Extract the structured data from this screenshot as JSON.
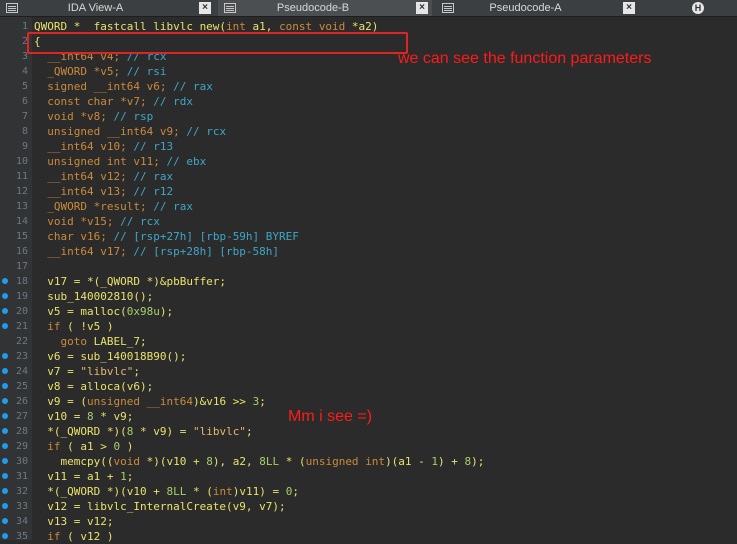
{
  "tabs": [
    {
      "label": "IDA View-A",
      "close": "×"
    },
    {
      "label": "Pseudocode-B",
      "close": "×"
    },
    {
      "label": "Pseudocode-A",
      "close": "×"
    },
    {
      "label": "",
      "icon": "hex-view-icon"
    }
  ],
  "annotations": {
    "params_note": "we can see the function parameters",
    "see_note": "Mm i see =)"
  },
  "code": {
    "lines": [
      {
        "n": "1",
        "parts": [
          [
            "QWORD *__fastcall libvlc_new(int a1, const void *a2)",
            "y"
          ]
        ],
        "dot": false
      },
      {
        "n": "2",
        "parts": [
          [
            "{",
            "y"
          ]
        ],
        "dot": false
      },
      {
        "n": "3",
        "parts": [
          [
            "  __int64 v4; // rcx",
            "c"
          ]
        ],
        "dot": false
      },
      {
        "n": "4",
        "parts": [
          [
            "  _QWORD *v5; // rsi",
            "c"
          ]
        ],
        "dot": false
      },
      {
        "n": "5",
        "parts": [
          [
            "  signed __int64 v6; // rax",
            "c"
          ]
        ],
        "dot": false
      },
      {
        "n": "6",
        "parts": [
          [
            "  const char *v7; // rdx",
            "c"
          ]
        ],
        "dot": false
      },
      {
        "n": "7",
        "parts": [
          [
            "  void *v8; // rsp",
            "c"
          ]
        ],
        "dot": false
      },
      {
        "n": "8",
        "parts": [
          [
            "  unsigned __int64 v9; // rcx",
            "c"
          ]
        ],
        "dot": false
      },
      {
        "n": "9",
        "parts": [
          [
            "  __int64 v10; // r13",
            "c"
          ]
        ],
        "dot": false
      },
      {
        "n": "10",
        "parts": [
          [
            "  unsigned int v11; // ebx",
            "c"
          ]
        ],
        "dot": false
      },
      {
        "n": "11",
        "parts": [
          [
            "  __int64 v12; // rax",
            "c"
          ]
        ],
        "dot": false
      },
      {
        "n": "12",
        "parts": [
          [
            "  __int64 v13; // r12",
            "c"
          ]
        ],
        "dot": false
      },
      {
        "n": "13",
        "parts": [
          [
            "  _QWORD *result; // rax",
            "c"
          ]
        ],
        "dot": false
      },
      {
        "n": "14",
        "parts": [
          [
            "  void *v15; // rcx",
            "c"
          ]
        ],
        "dot": false
      },
      {
        "n": "15",
        "parts": [
          [
            "  char v16; // [rsp+27h] [rbp-59h] BYREF",
            "c"
          ]
        ],
        "dot": false
      },
      {
        "n": "16",
        "parts": [
          [
            "  __int64 v17; // [rsp+28h] [rbp-58h]",
            "c"
          ]
        ],
        "dot": false
      },
      {
        "n": "17",
        "parts": [
          [
            "",
            "c"
          ]
        ],
        "dot": false
      },
      {
        "n": "18",
        "parts": [
          [
            "  v17 = *(_QWORD *)&pbBuffer;",
            "y"
          ]
        ],
        "dot": true
      },
      {
        "n": "19",
        "parts": [
          [
            "  sub_140002810();",
            "y"
          ]
        ],
        "dot": true
      },
      {
        "n": "20",
        "parts": [
          [
            "  v5 = malloc(0x98u);",
            "y"
          ]
        ],
        "dot": true
      },
      {
        "n": "21",
        "parts": [
          [
            "  if ( !v5 )",
            "y"
          ]
        ],
        "dot": true
      },
      {
        "n": "22",
        "parts": [
          [
            "    goto LABEL_7;",
            "y"
          ]
        ],
        "dot": false
      },
      {
        "n": "23",
        "parts": [
          [
            "  v6 = sub_140018B90();",
            "y"
          ]
        ],
        "dot": true
      },
      {
        "n": "24",
        "parts": [
          [
            "  v7 = \"libvlc\";",
            "y"
          ]
        ],
        "dot": true
      },
      {
        "n": "25",
        "parts": [
          [
            "  v8 = alloca(v6);",
            "y"
          ]
        ],
        "dot": true
      },
      {
        "n": "26",
        "parts": [
          [
            "  v9 = (unsigned __int64)&v16 >> 3;",
            "y"
          ]
        ],
        "dot": true
      },
      {
        "n": "27",
        "parts": [
          [
            "  v10 = 8 * v9;",
            "y"
          ]
        ],
        "dot": true
      },
      {
        "n": "28",
        "parts": [
          [
            "  *(_QWORD *)(8 * v9) = \"libvlc\";",
            "y"
          ]
        ],
        "dot": true
      },
      {
        "n": "29",
        "parts": [
          [
            "  if ( a1 > 0 )",
            "y"
          ]
        ],
        "dot": true
      },
      {
        "n": "30",
        "parts": [
          [
            "    memcpy((void *)(v10 + 8), a2, 8LL * (unsigned int)(a1 - 1) + 8);",
            "y"
          ]
        ],
        "dot": true
      },
      {
        "n": "31",
        "parts": [
          [
            "  v11 = a1 + 1;",
            "y"
          ]
        ],
        "dot": true
      },
      {
        "n": "32",
        "parts": [
          [
            "  *(_QWORD *)(v10 + 8LL * (int)v11) = 0;",
            "y"
          ]
        ],
        "dot": true
      },
      {
        "n": "33",
        "parts": [
          [
            "  v12 = libvlc_InternalCreate(v9, v7);",
            "y"
          ]
        ],
        "dot": true
      },
      {
        "n": "34",
        "parts": [
          [
            "  v13 = v12;",
            "y"
          ]
        ],
        "dot": true
      },
      {
        "n": "35",
        "parts": [
          [
            "  if ( v12 )",
            "y"
          ]
        ],
        "dot": true
      }
    ]
  },
  "colors": {
    "background": "#2b2b2b",
    "annotation_red": "#ff1a1a",
    "breakpoint_dot": "#1f9cf0"
  }
}
